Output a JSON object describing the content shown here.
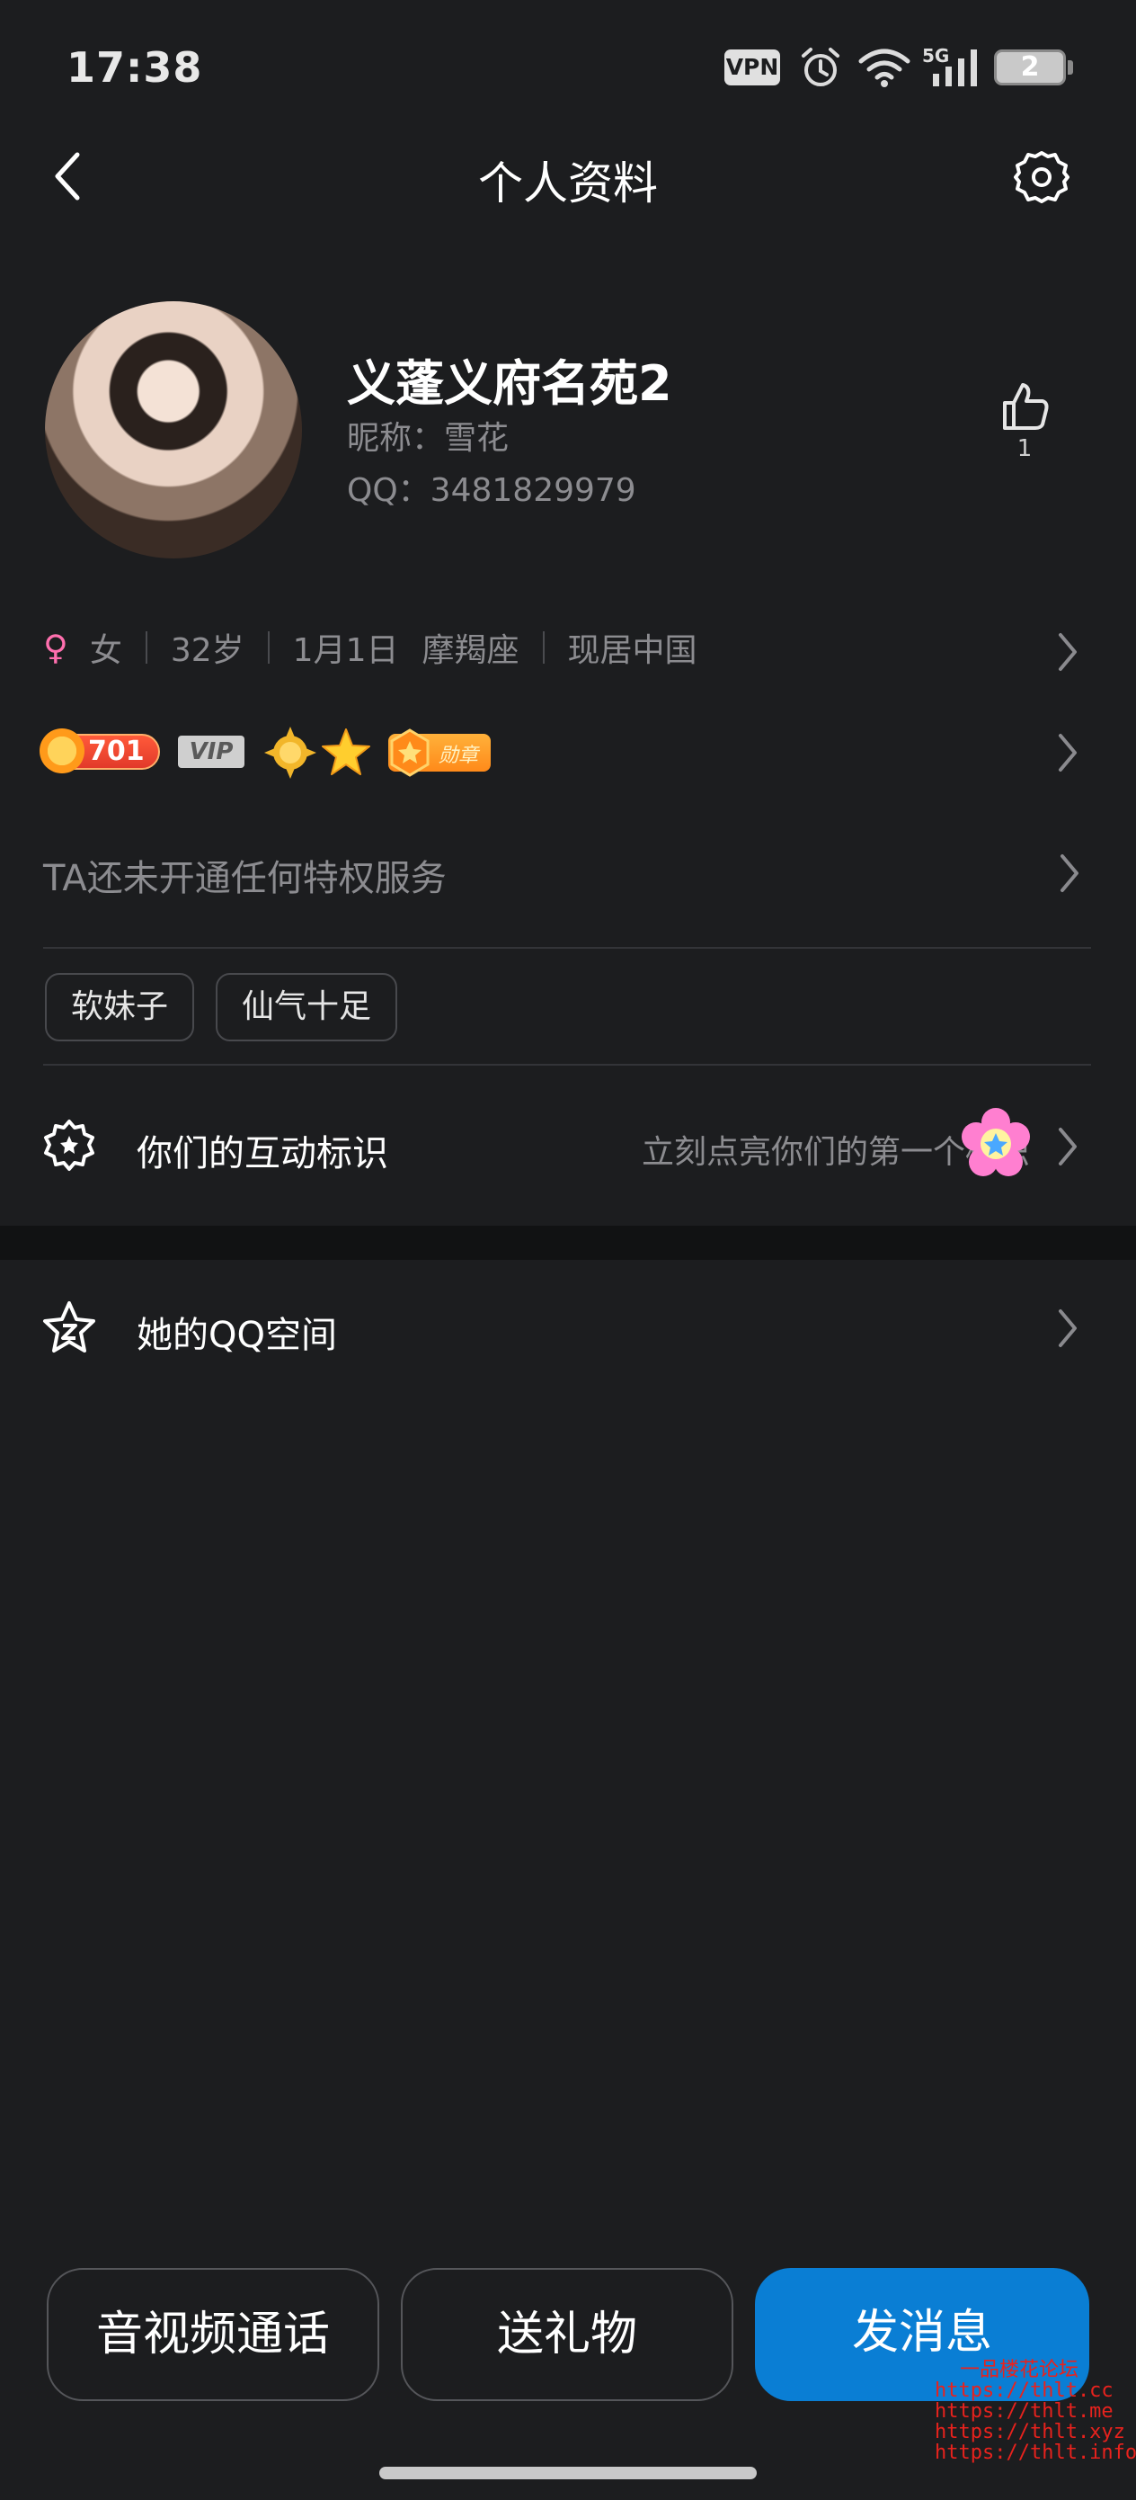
{
  "status_bar": {
    "time": "17:38",
    "vpn_label": "VPN",
    "network_label": "5G",
    "battery_level": "2"
  },
  "header": {
    "title": "个人资料",
    "back_icon": "chevron-left-icon",
    "settings_icon": "gear-icon"
  },
  "profile": {
    "display_name": "义蓬义府名苑2",
    "nickname": "昵称：雪花",
    "qq": "QQ：3481829979",
    "like_count": "1"
  },
  "info": {
    "gender_symbol": "♀",
    "gender": "女",
    "age": "32岁",
    "birthday": "1月1日",
    "zodiac": "摩羯座",
    "location": "现居中国"
  },
  "badges": {
    "level": "701",
    "vip": "VIP",
    "medal": "勋章"
  },
  "privilege": {
    "text": "TA还未开通任何特权服务"
  },
  "tags": [
    "软妹子",
    "仙气十足"
  ],
  "interaction": {
    "label": "你们的互动标识",
    "hint": "立刻点亮你们的第一个标识"
  },
  "qzone": {
    "label": "她的QQ空间"
  },
  "actions": {
    "call": "音视频通话",
    "gift": "送礼物",
    "message": "发消息"
  },
  "watermark": [
    "一品楼花论坛",
    "https://thlt.cc",
    "https://thlt.me",
    "https://thlt.xyz",
    "https://thlt.info"
  ],
  "colors": {
    "background": "#1c1d1f",
    "primary_button": "#0a7ed4",
    "gender_icon": "#ff6fae",
    "secondary_text": "#8c8c90"
  }
}
